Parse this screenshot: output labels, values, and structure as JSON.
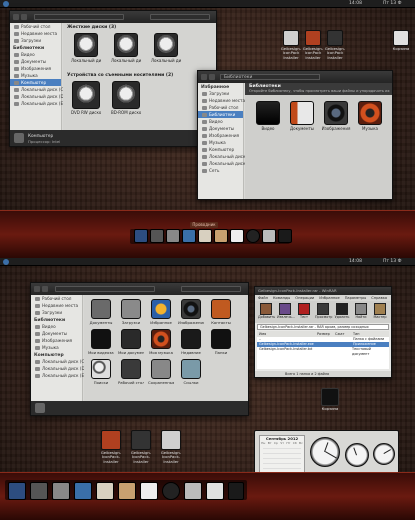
{
  "top": {
    "panel": {
      "clock": "14:08",
      "day": "Пт 13 Ф"
    },
    "explorer": {
      "sidebar": [
        "Рабочий стол",
        "Недавние места",
        "Загрузки",
        "Библиотеки",
        "Видео",
        "Документы",
        "Изображения",
        "Музыка",
        "Компьютер",
        "Локальный диск (C:)",
        "Локальный диск (D:)",
        "Локальный диск (E:)"
      ],
      "section1": "Жесткие диски (3)",
      "section2": "Устройства со съемными носителями (2)",
      "drives": [
        "Локальный диск (C:)",
        "Локальный диск (D:)",
        "Локальный диск (E:)"
      ],
      "removable": [
        "DVD RW дисковод (F:)",
        "BD-ROM дисковод (G:)"
      ],
      "status": [
        "Компьютер",
        "Процессор: Intel"
      ]
    },
    "library": {
      "title": "Библиотеки",
      "address": "Библиотеки",
      "heading": "Библиотеки",
      "subheading": "Откройте библиотеку, чтобы просмотреть ваши файлы и упорядочить их",
      "sidebar": [
        "Избранное",
        "Загрузки",
        "Недавние места",
        "Рабочий стол",
        "Библиотеки",
        "Видео",
        "Документы",
        "Изображения",
        "Музыка",
        "Компьютер",
        "Локальный диск",
        "Локальный диск",
        "Сеть"
      ],
      "items": [
        "Видео",
        "Документы",
        "Изображения",
        "Музыка"
      ]
    },
    "desktop_icons": [
      {
        "label": "Gelbesign-IconPack Installer",
        "color": "#cfcfcf"
      },
      {
        "label": "Gelbesign-IconPack Installer",
        "color": "#b04020"
      },
      {
        "label": "Gelbesign-IconPack Installer",
        "color": "#333333"
      },
      {
        "label": "Корзина",
        "color": "#e0e0e0"
      }
    ],
    "dock_label": "Проводник"
  },
  "bottom": {
    "panel": {
      "clock": "14:08",
      "day": "Пт 13 Ф"
    },
    "explorer": {
      "sidebar": [
        "Рабочий стол",
        "Недавние места",
        "Загрузки",
        "Библиотеки",
        "Видео",
        "Документы",
        "Изображения",
        "Музыка",
        "Компьютер",
        "Локальный диск (C:)",
        "Локальный диск (D:)",
        "Локальный диск (E:)"
      ],
      "items": [
        "Документы",
        "Загрузки",
        "Избранное",
        "Изображения",
        "Контакты",
        "Мои видеозаписи",
        "Мои документы",
        "Моя музыка",
        "Недавние",
        "Папки",
        "Поиски",
        "Рабочий стол",
        "Сохраненные игры",
        "Ссылки"
      ]
    },
    "winrar": {
      "title": "Gelbesign-IconPack-Installer.rar - WinRAR",
      "menu": [
        "Файл",
        "Команды",
        "Операции",
        "Избранное",
        "Параметры",
        "Справка"
      ],
      "toolbar": [
        "Добавить",
        "Извлечь...",
        "Тест",
        "Просмотр",
        "Удалить",
        "Найти",
        "Мастер"
      ],
      "path": "Gelbesign-IconPack-Installer.rar - RAR архив, размер исходных",
      "columns": [
        "Имя",
        "Размер",
        "Сжат",
        "Тип"
      ],
      "rows": [
        {
          "name": "..",
          "type": "Папка с файлами"
        },
        {
          "name": "Gelbesign-IconPack-Installer.exe",
          "type": "Приложение"
        },
        {
          "name": "Gelbesign-IconPack-Installer.txt",
          "type": "Текстовый документ"
        }
      ],
      "status": "Всего 1 папка и 2 файла"
    },
    "trash_label": "Корзина",
    "desktop_icons": [
      "Gelbesign-IconPack-Installer",
      "Gelbesign-IconPack-Installer",
      "Gelbesign-IconPack-Installer"
    ],
    "gadget": {
      "month": "Сентябрь 2012",
      "weekdays": [
        "Пн",
        "Вт",
        "Ср",
        "Чт",
        "Пт",
        "Сб",
        "Вс"
      ],
      "caption": "Получить дополнительные гаджеты в Интернете"
    }
  },
  "colors": {
    "accent": "#4a7fc0",
    "dock_red": "#6a1a10",
    "leather": "#3a2418"
  }
}
